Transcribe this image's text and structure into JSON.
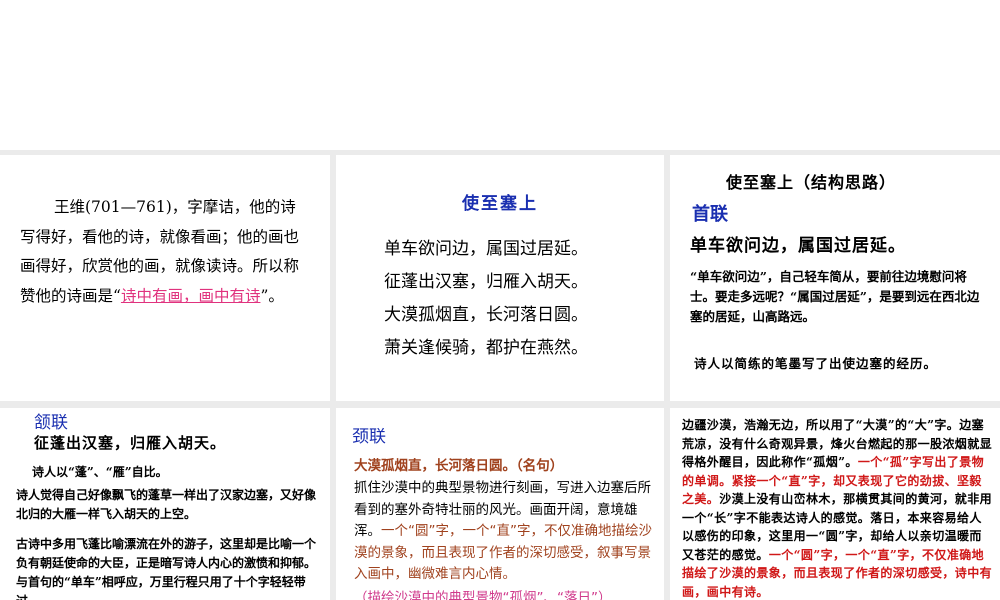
{
  "slides": {
    "s1": {
      "para_a": "王维(701—761)，字摩诘，他的诗写得好，看他的诗，就像看画；他的画也画得好，欣赏他的画，就像读诗。所以称赞他的诗画是“",
      "link": "诗中有画，画中有诗",
      "para_b": "”。"
    },
    "s2": {
      "title": "使至塞上",
      "poem": [
        "单车欲问边，属国过居延。",
        "征蓬出汉塞，归雁入胡天。",
        "大漠孤烟直，长河落日圆。",
        "萧关逢候骑，都护在燕然。"
      ]
    },
    "s3": {
      "title": "使至塞上（结构思路）",
      "lian": "首联",
      "line": "单车欲问边，属国过居延。",
      "note": "“单车欲问边”，自己轻车简从，要前往边境慰问将士。要走多远呢？“属国过居延”，是要到远在西北边塞的居延，山高路远。",
      "summary": "诗人以简练的笔墨写了出使边塞的经历。"
    },
    "s4": {
      "lian": "颔联",
      "line": "征蓬出汉塞，归雁入胡天。",
      "t1": "诗人以“蓬”、“雁”自比。",
      "t2": "诗人觉得自己好像飘飞的蓬草一样出了汉家边塞，又好像北归的大雁一样飞入胡天的上空。",
      "t3": "古诗中多用飞蓬比喻漂流在外的游子，这里却是比喻一个负有朝廷使命的大臣，正是暗写诗人内心的激愤和抑郁。与首句的“单车”相呼应，万里行程只用了十个字轻轻带过。"
    },
    "s5": {
      "lian": "颈联",
      "line": "大漠孤烟直，长河落日圆。（名句）",
      "body_a": "抓住沙漠中的典型景物进行刻画，写进入边塞后所看到的塞外奇特壮丽的风光。画面开阔，意境雄浑。",
      "body_b": "一个“圆”字，一个“直”字，不仅准确地描绘沙漠的景象，而且表现了作者的深切感受，叙事写景入画中，幽微难言内心情。",
      "sub": "（描绘沙漠中的典型景物“孤烟”、“落日”）"
    },
    "s6": {
      "text_a": "边疆沙漠，浩瀚无边，所以用了“大漠”的“大”字。边塞荒凉，没有什么奇观异景，烽火台燃起的那一股浓烟就显得格外醒目，因此称作“孤烟”。",
      "text_b": "一个“孤”字写出了景物的单调。紧接一个“直”字，却又表现了它的劲拔、坚毅之美。",
      "text_c": "沙漠上没有山峦林木，那横贯其间的黄河，就非用一个“长”字不能表达诗人的感觉。落日，本来容易给人以感伤的印象，这里用一“圆”字，却给人以亲切温暖而又苍茫的感觉。",
      "text_d": "一个“圆”字，一个“直”字，不仅准确地描绘了沙漠的景象，而且表现了作者的深切感受，诗中有画，画中有诗。"
    }
  },
  "colors": {
    "blue": "#1a2fb0",
    "pink": "#e0327e",
    "brown": "#a0421e",
    "red": "#d01818"
  }
}
